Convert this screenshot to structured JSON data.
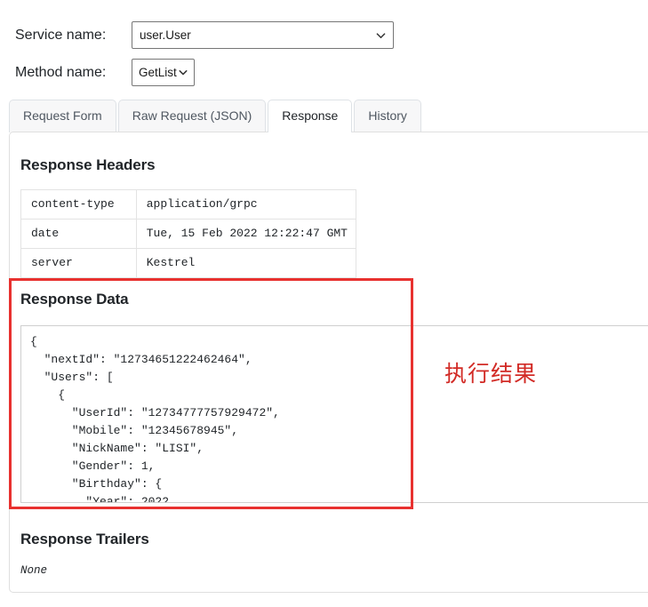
{
  "form": {
    "service_label": "Service name:",
    "service_value": "user.User",
    "method_label": "Method name:",
    "method_value": "GetList"
  },
  "tabs": [
    {
      "label": "Request Form",
      "active": false
    },
    {
      "label": "Raw Request (JSON)",
      "active": false
    },
    {
      "label": "Response",
      "active": true
    },
    {
      "label": "History",
      "active": false
    }
  ],
  "response": {
    "headers_title": "Response Headers",
    "headers": [
      {
        "key": "content-type",
        "value": "application/grpc"
      },
      {
        "key": "date",
        "value": "Tue, 15 Feb 2022 12:22:47 GMT"
      },
      {
        "key": "server",
        "value": "Kestrel"
      }
    ],
    "data_title": "Response Data",
    "data_json": "{\n  \"nextId\": \"12734651222462464\",\n  \"Users\": [\n    {\n      \"UserId\": \"12734777757929472\",\n      \"Mobile\": \"12345678945\",\n      \"NickName\": \"LISI\",\n      \"Gender\": 1,\n      \"Birthday\": {\n        \"Year\": 2022,",
    "trailers_title": "Response Trailers",
    "trailers_value": "None"
  },
  "annotation": {
    "text": "执行结果",
    "color": "#d22b26"
  }
}
